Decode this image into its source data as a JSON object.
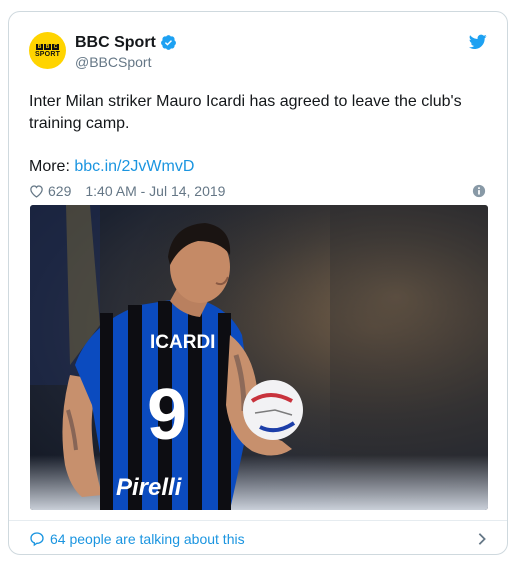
{
  "author": {
    "name": "BBC Sport",
    "handle": "@BBCSport",
    "avatar": {
      "line1": [
        "B",
        "B",
        "C"
      ],
      "line2": "SPORT",
      "bg": "#ffd400"
    },
    "verified": true
  },
  "tweet": {
    "text": "Inter Milan striker Mauro Icardi has agreed to leave the club's training camp.",
    "more_label": "More:",
    "link": "bbc.in/2JvWmvD"
  },
  "meta": {
    "likes": "629",
    "timestamp": "1:40 AM - Jul 14, 2019"
  },
  "media": {
    "jersey_name": "ICARDI",
    "jersey_number": "9",
    "sponsor": "Pirelli"
  },
  "footer": {
    "talking": "64 people are talking about this"
  },
  "colors": {
    "accent": "#1b95e0",
    "text": "#14171a",
    "muted": "#657786",
    "inter_blue": "#0b4bbf"
  },
  "icons": [
    "verified-badge-icon",
    "twitter-bird-icon",
    "heart-icon",
    "info-icon",
    "speech-bubble-icon",
    "chevron-right-icon"
  ]
}
